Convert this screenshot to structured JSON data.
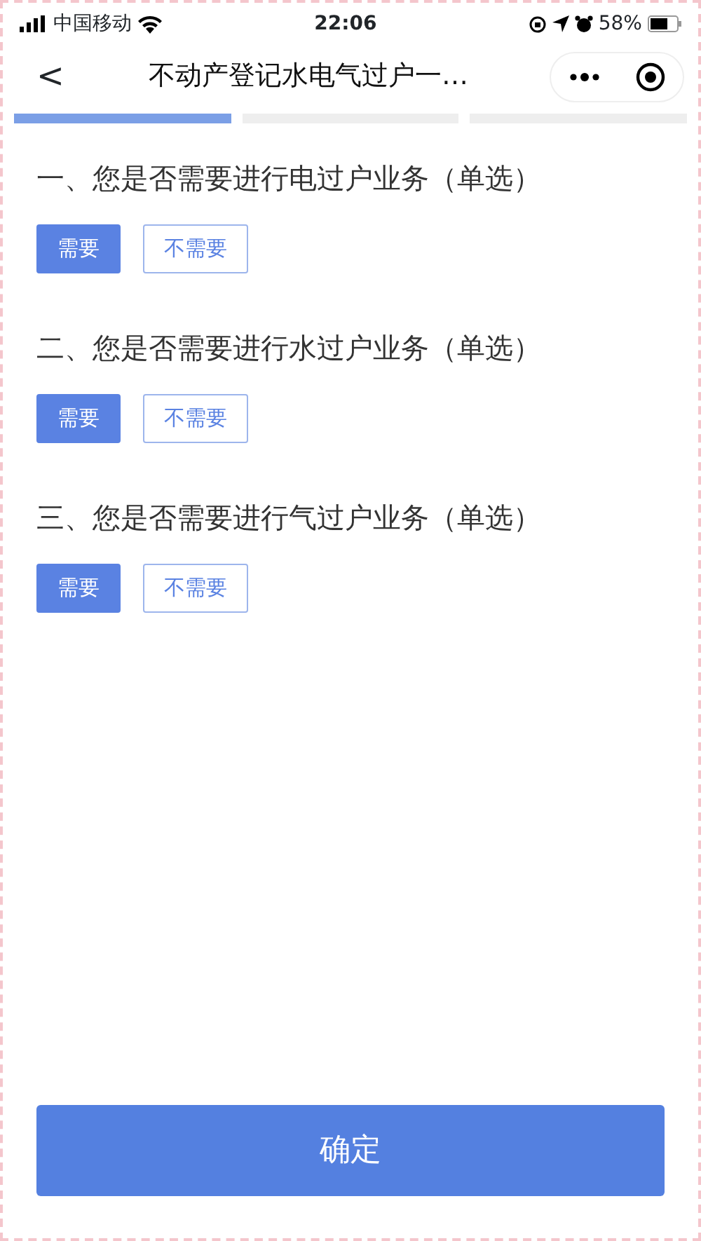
{
  "status_bar": {
    "carrier": "中国移动",
    "time": "22:06",
    "battery": "58%"
  },
  "nav": {
    "back": "<",
    "title": "不动产登记水电气过户一…"
  },
  "progress": [
    {
      "done": true
    },
    {
      "done": false
    },
    {
      "done": false
    }
  ],
  "questions": [
    {
      "title": "一、您是否需要进行电过户业务（单选）",
      "options": [
        {
          "label": "需要",
          "selected": true
        },
        {
          "label": "不需要",
          "selected": false
        }
      ]
    },
    {
      "title": "二、您是否需要进行水过户业务（单选）",
      "options": [
        {
          "label": "需要",
          "selected": true
        },
        {
          "label": "不需要",
          "selected": false
        }
      ]
    },
    {
      "title": "三、您是否需要进行气过户业务（单选）",
      "options": [
        {
          "label": "需要",
          "selected": true
        },
        {
          "label": "不需要",
          "selected": false
        }
      ]
    }
  ],
  "confirm": "确定"
}
